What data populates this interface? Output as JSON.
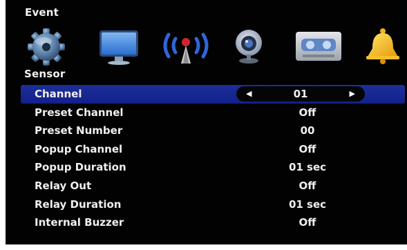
{
  "event_title": "Event",
  "sensor_title": "Sensor",
  "icons": [
    "gear-icon",
    "monitor-icon",
    "wireless-icon",
    "webcam-icon",
    "recorder-icon",
    "bell-icon"
  ],
  "colors": {
    "background": "#020202",
    "selected_row": "#1d2f9a",
    "text": "#efefef"
  },
  "rows": [
    {
      "label": "Channel",
      "value": "01",
      "selected": true
    },
    {
      "label": "Preset Channel",
      "value": "Off"
    },
    {
      "label": "Preset Number",
      "value": "00"
    },
    {
      "label": "Popup Channel",
      "value": "Off"
    },
    {
      "label": "Popup Duration",
      "value": "01 sec"
    },
    {
      "label": "Relay Out",
      "value": "Off"
    },
    {
      "label": "Relay Duration",
      "value": "01 sec"
    },
    {
      "label": "Internal Buzzer",
      "value": "Off"
    }
  ]
}
